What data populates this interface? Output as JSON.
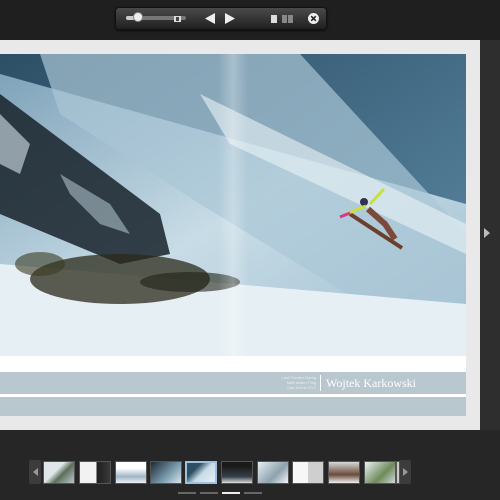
{
  "toolbar": {
    "zoom_level": 0.2,
    "icons": [
      "zoom-slider",
      "fit-page-icon",
      "previous-page-icon",
      "next-page-icon",
      "single-page-icon",
      "double-page-icon",
      "close-icon"
    ]
  },
  "spread": {
    "photo_credit_small": [
      "Last Frontier Noreg",
      "Matt Walter Flag",
      "Mat Jindra 2012"
    ],
    "photographer": "Wojtek Karkowski"
  },
  "thumbnails": {
    "count": 11,
    "selected_index": 4,
    "page_indicators": 4,
    "active_indicator": 2
  },
  "colors": {
    "accent": "#9cc2e0",
    "caption_band": "#b9c7ce",
    "background": "#2b2b2b"
  }
}
